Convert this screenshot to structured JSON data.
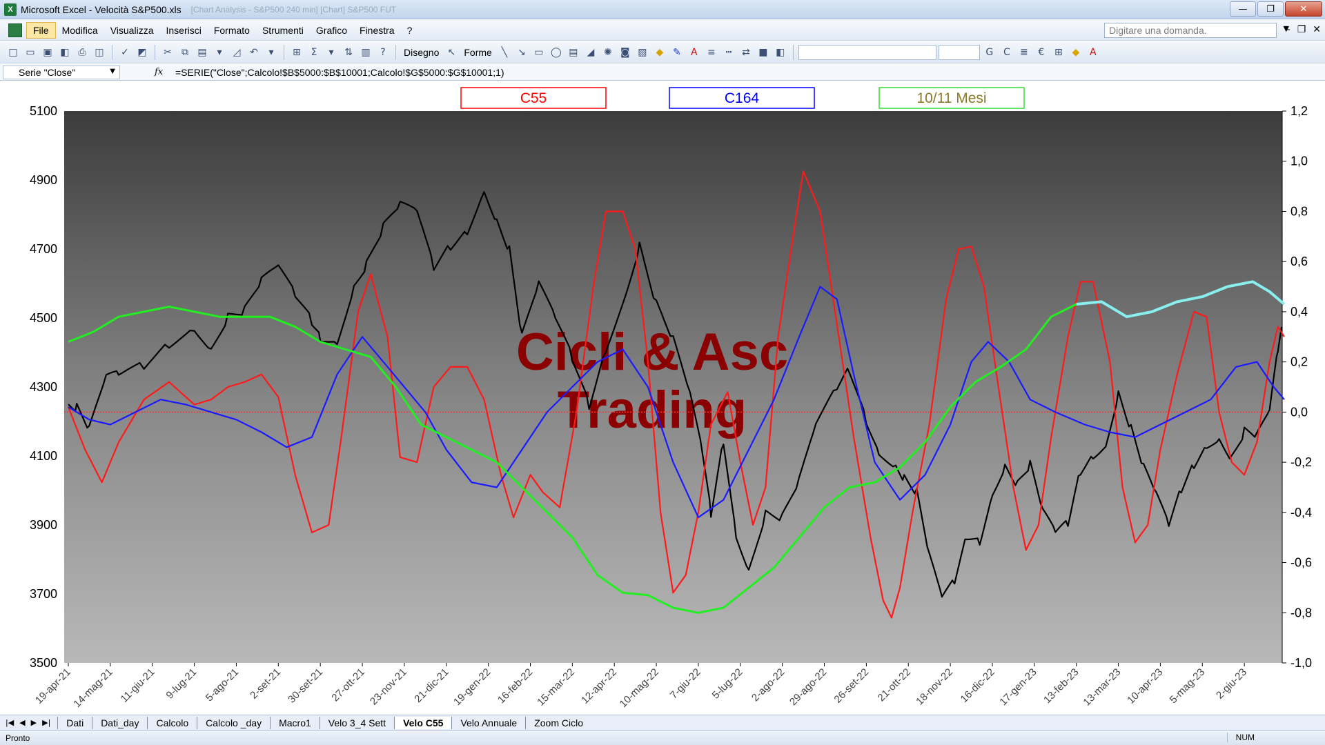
{
  "window": {
    "title": "Microsoft Excel - Velocità S&P500.xls",
    "ghost_text": "[Chart Analysis - S&P500 240 min]  [Chart]  S&P500 FUT",
    "buttons": {
      "minimize": "—",
      "maximize": "❐",
      "close": "✕"
    }
  },
  "menu": {
    "items": [
      "File",
      "Modifica",
      "Visualizza",
      "Inserisci",
      "Formato",
      "Strumenti",
      "Grafico",
      "Finestra",
      "?"
    ],
    "help_placeholder": "Digitare una domanda.",
    "doc_buttons": [
      "–",
      "❐",
      "✕"
    ]
  },
  "toolbar": {
    "disegno_label": "Disegno",
    "forme_label": "Forme"
  },
  "formula_bar": {
    "name_box": "Serie \"Close\"",
    "fx": "fx",
    "formula": "=SERIE(\"Close\";Calcolo!$B$5000:$B$10001;Calcolo!$G$5000:$G$10001;1)"
  },
  "chart": {
    "watermark_line1": "Cicli & Asc",
    "watermark_line2": "Trading",
    "legend": [
      {
        "label": "C55",
        "color": "#ff0000"
      },
      {
        "label": "C164",
        "color": "#0000ff"
      },
      {
        "label": "10/11 Mesi",
        "color": "#8a7a2a",
        "border": "#33dd33"
      }
    ],
    "colors": {
      "price": "#000000",
      "c55": "#ff1a1a",
      "c164": "#1a1aff",
      "mesi": "#22ee22",
      "mesi_future": "#88eeee",
      "zero_line": "#ff3030"
    }
  },
  "chart_data": {
    "type": "line",
    "y_left": {
      "min": 3500,
      "max": 5100,
      "ticks": [
        "5100",
        "4900",
        "4700",
        "4500",
        "4300",
        "4100",
        "3900",
        "3700",
        "3500"
      ]
    },
    "y_right": {
      "min": -1.0,
      "max": 1.2,
      "ticks": [
        "1,2",
        "1,0",
        "0,8",
        "0,6",
        "0,4",
        "0,2",
        "0,0",
        "-0,2",
        "-0,4",
        "-0,6",
        "-0,8",
        "-1,0"
      ]
    },
    "x_ticks": [
      "19-apr-21",
      "14-mag-21",
      "11-giu-21",
      "9-lug-21",
      "5-ago-21",
      "2-set-21",
      "30-set-21",
      "27-ott-21",
      "23-nov-21",
      "21-dic-21",
      "19-gen-22",
      "16-feb-22",
      "15-mar-22",
      "12-apr-22",
      "10-mag-22",
      "7-giu-22",
      "5-lug-22",
      "2-ago-22",
      "29-ago-22",
      "26-set-22",
      "21-ott-22",
      "18-nov-22",
      "16-dic-22",
      "17-gen-23",
      "13-feb-23",
      "13-mar-23",
      "10-apr-23",
      "5-mag-23",
      "2-giu-23"
    ],
    "series": [
      {
        "name": "Close",
        "axis": "left",
        "points": [
          [
            0,
            4250
          ],
          [
            0.2,
            4240
          ],
          [
            0.5,
            4170
          ],
          [
            0.9,
            4320
          ],
          [
            1.2,
            4330
          ],
          [
            1.8,
            4360
          ],
          [
            2.4,
            4430
          ],
          [
            3.0,
            4480
          ],
          [
            3.4,
            4420
          ],
          [
            3.8,
            4510
          ],
          [
            4.2,
            4520
          ],
          [
            4.6,
            4600
          ],
          [
            5.0,
            4640
          ],
          [
            5.4,
            4560
          ],
          [
            5.8,
            4490
          ],
          [
            6.0,
            4450
          ],
          [
            6.4,
            4440
          ],
          [
            6.8,
            4600
          ],
          [
            7.1,
            4660
          ],
          [
            7.5,
            4760
          ],
          [
            7.9,
            4820
          ],
          [
            8.3,
            4800
          ],
          [
            8.7,
            4640
          ],
          [
            9.1,
            4710
          ],
          [
            9.5,
            4760
          ],
          [
            9.9,
            4880
          ],
          [
            10.2,
            4790
          ],
          [
            10.5,
            4700
          ],
          [
            10.8,
            4440
          ],
          [
            11.2,
            4590
          ],
          [
            11.6,
            4490
          ],
          [
            12.0,
            4380
          ],
          [
            12.4,
            4250
          ],
          [
            12.8,
            4420
          ],
          [
            13.3,
            4590
          ],
          [
            13.6,
            4720
          ],
          [
            14.0,
            4540
          ],
          [
            14.4,
            4430
          ],
          [
            14.8,
            4270
          ],
          [
            15.1,
            4100
          ],
          [
            15.3,
            3930
          ],
          [
            15.6,
            4150
          ],
          [
            15.9,
            3880
          ],
          [
            16.2,
            3780
          ],
          [
            16.6,
            3940
          ],
          [
            17.0,
            3920
          ],
          [
            17.4,
            4020
          ],
          [
            17.8,
            4180
          ],
          [
            18.3,
            4290
          ],
          [
            18.6,
            4350
          ],
          [
            19.0,
            4210
          ],
          [
            19.3,
            4120
          ],
          [
            19.7,
            4080
          ],
          [
            19.9,
            4040
          ],
          [
            20.2,
            3990
          ],
          [
            20.5,
            3800
          ],
          [
            20.8,
            3680
          ],
          [
            21.1,
            3730
          ],
          [
            21.4,
            3870
          ],
          [
            21.7,
            3860
          ],
          [
            22.0,
            4000
          ],
          [
            22.3,
            4080
          ],
          [
            22.6,
            4020
          ],
          [
            22.9,
            4070
          ],
          [
            23.2,
            3930
          ],
          [
            23.5,
            3870
          ],
          [
            23.8,
            3900
          ],
          [
            24.1,
            4060
          ],
          [
            24.4,
            4110
          ],
          [
            24.7,
            4140
          ],
          [
            25.0,
            4290
          ],
          [
            25.3,
            4180
          ],
          [
            25.6,
            4060
          ],
          [
            25.9,
            3980
          ],
          [
            26.2,
            3890
          ],
          [
            26.5,
            4000
          ],
          [
            26.8,
            4080
          ],
          [
            27.1,
            4140
          ],
          [
            27.4,
            4160
          ],
          [
            27.7,
            4100
          ],
          [
            28.0,
            4170
          ],
          [
            28.3,
            4150
          ],
          [
            28.6,
            4220
          ],
          [
            28.8,
            4400
          ],
          [
            28.9,
            4470
          ]
        ]
      },
      {
        "name": "C55",
        "axis": "right",
        "points": [
          [
            0,
            0.02
          ],
          [
            0.4,
            -0.15
          ],
          [
            0.8,
            -0.28
          ],
          [
            1.2,
            -0.12
          ],
          [
            1.8,
            0.05
          ],
          [
            2.4,
            0.12
          ],
          [
            3.0,
            0.03
          ],
          [
            3.4,
            0.05
          ],
          [
            3.8,
            0.1
          ],
          [
            4.2,
            0.12
          ],
          [
            4.6,
            0.15
          ],
          [
            5.0,
            0.06
          ],
          [
            5.4,
            -0.25
          ],
          [
            5.8,
            -0.48
          ],
          [
            6.2,
            -0.45
          ],
          [
            6.5,
            -0.1
          ],
          [
            6.9,
            0.4
          ],
          [
            7.2,
            0.55
          ],
          [
            7.6,
            0.3
          ],
          [
            7.9,
            -0.18
          ],
          [
            8.3,
            -0.2
          ],
          [
            8.7,
            0.1
          ],
          [
            9.1,
            0.18
          ],
          [
            9.5,
            0.18
          ],
          [
            9.9,
            0.05
          ],
          [
            10.3,
            -0.25
          ],
          [
            10.6,
            -0.42
          ],
          [
            11.0,
            -0.25
          ],
          [
            11.3,
            -0.32
          ],
          [
            11.7,
            -0.38
          ],
          [
            12.1,
            0.0
          ],
          [
            12.5,
            0.5
          ],
          [
            12.8,
            0.8
          ],
          [
            13.2,
            0.8
          ],
          [
            13.5,
            0.65
          ],
          [
            13.8,
            0.2
          ],
          [
            14.1,
            -0.4
          ],
          [
            14.4,
            -0.72
          ],
          [
            14.7,
            -0.65
          ],
          [
            15.0,
            -0.4
          ],
          [
            15.3,
            -0.05
          ],
          [
            15.7,
            0.08
          ],
          [
            16.0,
            -0.2
          ],
          [
            16.3,
            -0.45
          ],
          [
            16.6,
            -0.3
          ],
          [
            16.9,
            0.3
          ],
          [
            17.3,
            0.75
          ],
          [
            17.5,
            0.96
          ],
          [
            17.9,
            0.8
          ],
          [
            18.3,
            0.35
          ],
          [
            18.7,
            -0.1
          ],
          [
            19.1,
            -0.5
          ],
          [
            19.4,
            -0.75
          ],
          [
            19.6,
            -0.82
          ],
          [
            19.8,
            -0.7
          ],
          [
            20.1,
            -0.4
          ],
          [
            20.5,
            -0.05
          ],
          [
            20.9,
            0.45
          ],
          [
            21.2,
            0.65
          ],
          [
            21.5,
            0.66
          ],
          [
            21.8,
            0.5
          ],
          [
            22.1,
            0.15
          ],
          [
            22.5,
            -0.3
          ],
          [
            22.8,
            -0.55
          ],
          [
            23.1,
            -0.45
          ],
          [
            23.4,
            -0.1
          ],
          [
            23.8,
            0.3
          ],
          [
            24.1,
            0.52
          ],
          [
            24.4,
            0.52
          ],
          [
            24.8,
            0.2
          ],
          [
            25.1,
            -0.3
          ],
          [
            25.4,
            -0.52
          ],
          [
            25.7,
            -0.45
          ],
          [
            26.0,
            -0.15
          ],
          [
            26.4,
            0.15
          ],
          [
            26.8,
            0.4
          ],
          [
            27.1,
            0.38
          ],
          [
            27.4,
            0.0
          ],
          [
            27.7,
            -0.2
          ],
          [
            28.0,
            -0.25
          ],
          [
            28.3,
            -0.12
          ],
          [
            28.6,
            0.2
          ],
          [
            28.8,
            0.34
          ],
          [
            28.95,
            0.3
          ]
        ]
      },
      {
        "name": "C164",
        "axis": "right",
        "points": [
          [
            0,
            0.02
          ],
          [
            0.5,
            -0.03
          ],
          [
            1.0,
            -0.05
          ],
          [
            1.6,
            0.0
          ],
          [
            2.2,
            0.05
          ],
          [
            2.8,
            0.03
          ],
          [
            3.4,
            0.0
          ],
          [
            4.0,
            -0.03
          ],
          [
            4.6,
            -0.08
          ],
          [
            5.2,
            -0.14
          ],
          [
            5.8,
            -0.1
          ],
          [
            6.4,
            0.15
          ],
          [
            7.0,
            0.3
          ],
          [
            7.5,
            0.2
          ],
          [
            8.0,
            0.1
          ],
          [
            8.5,
            0.0
          ],
          [
            9.0,
            -0.15
          ],
          [
            9.6,
            -0.28
          ],
          [
            10.2,
            -0.3
          ],
          [
            10.8,
            -0.15
          ],
          [
            11.4,
            0.0
          ],
          [
            12.0,
            0.1
          ],
          [
            12.6,
            0.2
          ],
          [
            13.2,
            0.25
          ],
          [
            13.8,
            0.1
          ],
          [
            14.4,
            -0.2
          ],
          [
            15.0,
            -0.42
          ],
          [
            15.6,
            -0.35
          ],
          [
            16.2,
            -0.15
          ],
          [
            16.8,
            0.05
          ],
          [
            17.4,
            0.3
          ],
          [
            17.9,
            0.5
          ],
          [
            18.3,
            0.45
          ],
          [
            18.7,
            0.15
          ],
          [
            19.2,
            -0.2
          ],
          [
            19.8,
            -0.35
          ],
          [
            20.4,
            -0.25
          ],
          [
            21.0,
            -0.05
          ],
          [
            21.5,
            0.2
          ],
          [
            21.9,
            0.28
          ],
          [
            22.4,
            0.2
          ],
          [
            22.9,
            0.05
          ],
          [
            23.5,
            0.0
          ],
          [
            24.2,
            -0.05
          ],
          [
            24.8,
            -0.08
          ],
          [
            25.4,
            -0.1
          ],
          [
            26.0,
            -0.05
          ],
          [
            26.6,
            0.0
          ],
          [
            27.2,
            0.05
          ],
          [
            27.8,
            0.18
          ],
          [
            28.3,
            0.2
          ],
          [
            28.7,
            0.1
          ],
          [
            28.95,
            0.05
          ]
        ]
      },
      {
        "name": "10/11 Mesi",
        "axis": "right",
        "points": [
          [
            0,
            0.28
          ],
          [
            0.6,
            0.32
          ],
          [
            1.2,
            0.38
          ],
          [
            1.8,
            0.4
          ],
          [
            2.4,
            0.42
          ],
          [
            3.0,
            0.4
          ],
          [
            3.6,
            0.38
          ],
          [
            4.2,
            0.38
          ],
          [
            4.8,
            0.38
          ],
          [
            5.4,
            0.34
          ],
          [
            6.0,
            0.28
          ],
          [
            6.6,
            0.25
          ],
          [
            7.2,
            0.22
          ],
          [
            7.8,
            0.1
          ],
          [
            8.4,
            -0.05
          ],
          [
            9.0,
            -0.1
          ],
          [
            9.6,
            -0.15
          ],
          [
            10.2,
            -0.2
          ],
          [
            10.8,
            -0.3
          ],
          [
            11.4,
            -0.4
          ],
          [
            12.0,
            -0.5
          ],
          [
            12.6,
            -0.65
          ],
          [
            13.2,
            -0.72
          ],
          [
            13.8,
            -0.73
          ],
          [
            14.4,
            -0.78
          ],
          [
            15.0,
            -0.8
          ],
          [
            15.6,
            -0.78
          ],
          [
            16.2,
            -0.7
          ],
          [
            16.8,
            -0.62
          ],
          [
            17.4,
            -0.5
          ],
          [
            18.0,
            -0.38
          ],
          [
            18.6,
            -0.3
          ],
          [
            19.2,
            -0.28
          ],
          [
            19.8,
            -0.22
          ],
          [
            20.4,
            -0.12
          ],
          [
            21.0,
            0.02
          ],
          [
            21.6,
            0.12
          ],
          [
            22.2,
            0.18
          ],
          [
            22.8,
            0.25
          ],
          [
            23.4,
            0.38
          ],
          [
            24.0,
            0.43
          ]
        ]
      },
      {
        "name": "10/11 Mesi (proiezione)",
        "axis": "right",
        "points": [
          [
            24.0,
            0.43
          ],
          [
            24.6,
            0.44
          ],
          [
            25.2,
            0.38
          ],
          [
            25.8,
            0.4
          ],
          [
            26.4,
            0.44
          ],
          [
            27.0,
            0.46
          ],
          [
            27.6,
            0.5
          ],
          [
            28.2,
            0.52
          ],
          [
            28.6,
            0.48
          ],
          [
            28.95,
            0.43
          ]
        ]
      }
    ]
  },
  "sheet_tabs": {
    "nav": [
      "|◀",
      "◀",
      "▶",
      "▶|"
    ],
    "tabs": [
      "Dati",
      "Dati_day",
      "Calcolo",
      "Calcolo _day",
      "Macro1",
      "Velo 3_4 Sett",
      "Velo C55",
      "Velo Annuale",
      "Zoom Ciclo"
    ],
    "active_index": 6
  },
  "status": {
    "left": "Pronto",
    "num": "NUM"
  }
}
